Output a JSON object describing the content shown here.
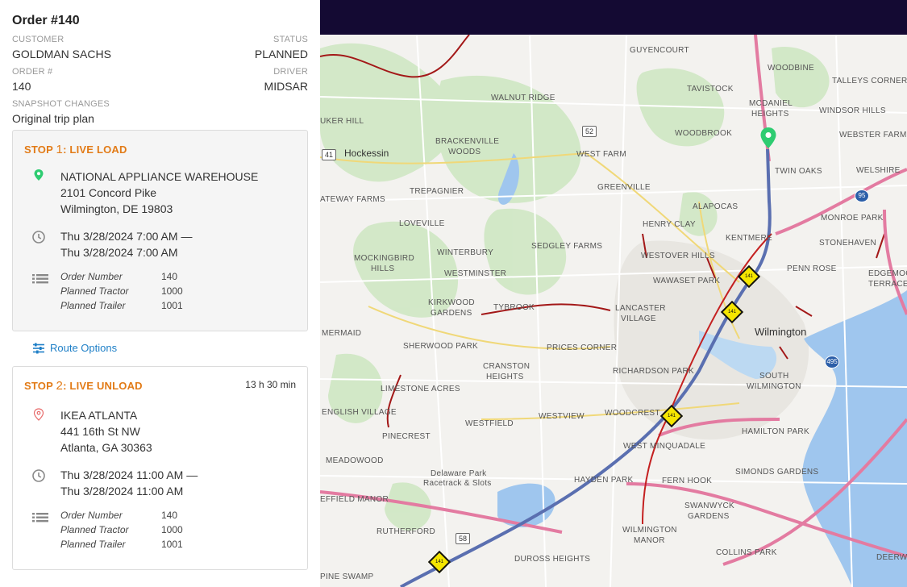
{
  "order": {
    "title": "Order #140",
    "customer_label": "CUSTOMER",
    "customer": "GOLDMAN SACHS",
    "status_label": "STATUS",
    "status": "PLANNED",
    "order_num_label": "ORDER #",
    "order_num": "140",
    "driver_label": "DRIVER",
    "driver": "MIDSAR",
    "snapshot_label": "SNAPSHOT CHANGES",
    "snapshot": "Original trip plan"
  },
  "stops": [
    {
      "head_prefix": "STOP ",
      "head_num": "1",
      "head_suffix": ": LIVE LOAD",
      "duration": "",
      "name": "NATIONAL APPLIANCE WAREHOUSE",
      "address1": "2101 Concord Pike",
      "address2": "Wilmington, DE 19803",
      "time1": "Thu 3/28/2024 7:00 AM —",
      "time2": "Thu 3/28/2024 7:00 AM",
      "details": [
        {
          "k": "Order Number",
          "v": "140"
        },
        {
          "k": "Planned Tractor",
          "v": "1000"
        },
        {
          "k": "Planned Trailer",
          "v": "1001"
        }
      ]
    },
    {
      "head_prefix": "STOP ",
      "head_num": "2",
      "head_suffix": ": LIVE UNLOAD",
      "duration": "13 h 30 min",
      "name": "IKEA ATLANTA",
      "address1": "441 16th St NW",
      "address2": "Atlanta, GA 30363",
      "time1": "Thu 3/28/2024 11:00 AM —",
      "time2": "Thu 3/28/2024 11:00 AM",
      "details": [
        {
          "k": "Order Number",
          "v": "140"
        },
        {
          "k": "Planned Tractor",
          "v": "1000"
        },
        {
          "k": "Planned Trailer",
          "v": "1001"
        }
      ]
    }
  ],
  "route_options_label": "Route Options",
  "map": {
    "city": "Wilmington",
    "place_hockessin": "Hockessin",
    "labels": [
      "GUYENCOURT",
      "WOODBINE",
      "TALLEYS CORNER",
      "TAVISTOCK",
      "MCDANIEL",
      "HEIGHTS",
      "WINDSOR HILLS",
      "WALNUT RIDGE",
      "WOODBROOK",
      "WEBSTER FARM",
      "UKER HILL",
      "BRACKENVILLE",
      "WOODS",
      "WEST FARM",
      "TWIN OAKS",
      "WELSHIRE",
      "TREPAGNIER",
      "GREENVILLE",
      "ATEWAY FARMS",
      "ALAPOCAS",
      "MONROE PARK",
      "LOVEVILLE",
      "HENRY CLAY",
      "KENTMERE",
      "STONEHAVEN",
      "SEDGLEY FARMS",
      "WINTERBURY",
      "MOCKINGBIRD",
      "HILLS",
      "WESTOVER HILLS",
      "PENN ROSE",
      "EDGEMOO",
      "TERRACE",
      "WESTMINSTER",
      "WAWASET PARK",
      "KIRKWOOD",
      "GARDENS",
      "TYBROOK",
      "LANCASTER",
      "VILLAGE",
      "MERMAID",
      "SHERWOOD PARK",
      "PRICES CORNER",
      "CRANSTON",
      "HEIGHTS",
      "RICHARDSON PARK",
      "SOUTH",
      "WILMINGTON",
      "LIMESTONE ACRES",
      "ENGLISH VILLAGE",
      "WOODCREST",
      "WESTVIEW",
      "WESTFIELD",
      "PINECREST",
      "WEST MINQUADALE",
      "HAMILTON PARK",
      "MEADOWOOD",
      "Delaware Park",
      "Racetrack & Slots",
      "HAYDEN PARK",
      "FERN HOOK",
      "SIMONDS GARDENS",
      "EFFIELD MANOR",
      "SWANWYCK",
      "GARDENS",
      "RUTHERFORD",
      "WILMINGTON",
      "MANOR",
      "COLLINS PARK",
      "DUROSS HEIGHTS",
      "PINE SWAMP",
      "DEERW"
    ],
    "shields": [
      "52",
      "41",
      "58"
    ],
    "interstates": [
      "95",
      "495"
    ],
    "diamonds": [
      "141",
      "141",
      "141",
      "141"
    ]
  },
  "colors": {
    "accent_orange": "#e27b17",
    "link_blue": "#1e7fc7",
    "pin_green": "#2ecc71",
    "map_topbar": "#140a33",
    "route": "#5a6fb0",
    "highway": "#e37ba1"
  },
  "icons": [
    "map-pin-icon",
    "clock-icon",
    "list-icon",
    "sliders-icon",
    "location-outline-icon",
    "destination-pin-icon"
  ]
}
